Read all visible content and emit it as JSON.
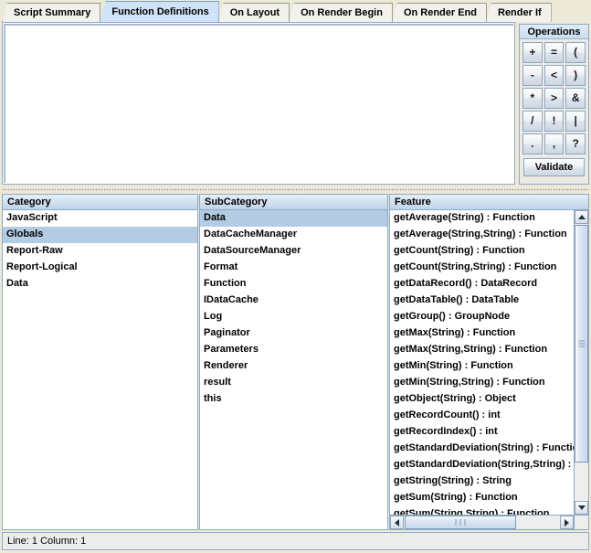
{
  "tabs": [
    {
      "label": "Script Summary",
      "selected": false
    },
    {
      "label": "Function Definitions",
      "selected": true
    },
    {
      "label": "On Layout",
      "selected": false
    },
    {
      "label": "On Render Begin",
      "selected": false
    },
    {
      "label": "On Render End",
      "selected": false
    },
    {
      "label": "Render If",
      "selected": false
    }
  ],
  "editor": {
    "content": "",
    "placeholder": ""
  },
  "operations": {
    "title": "Operations",
    "buttons": [
      "+",
      "=",
      "(",
      "-",
      "<",
      ")",
      "*",
      ">",
      "&",
      "/",
      "!",
      "|",
      ".",
      ",",
      "?"
    ],
    "validate_label": "Validate"
  },
  "category": {
    "header": "Category",
    "items": [
      {
        "label": "JavaScript",
        "selected": false
      },
      {
        "label": "Globals",
        "selected": true
      },
      {
        "label": "Report-Raw",
        "selected": false
      },
      {
        "label": "Report-Logical",
        "selected": false
      },
      {
        "label": "Data",
        "selected": false
      }
    ]
  },
  "subcategory": {
    "header": "SubCategory",
    "items": [
      {
        "label": "Data",
        "selected": true
      },
      {
        "label": "DataCacheManager",
        "selected": false
      },
      {
        "label": "DataSourceManager",
        "selected": false
      },
      {
        "label": "Format",
        "selected": false
      },
      {
        "label": "Function",
        "selected": false
      },
      {
        "label": "IDataCache",
        "selected": false
      },
      {
        "label": "Log",
        "selected": false
      },
      {
        "label": "Paginator",
        "selected": false
      },
      {
        "label": "Parameters",
        "selected": false
      },
      {
        "label": "Renderer",
        "selected": false
      },
      {
        "label": "result",
        "selected": false
      },
      {
        "label": "this",
        "selected": false
      }
    ]
  },
  "feature": {
    "header": "Feature",
    "items": [
      {
        "label": "getAverage(String) : Function",
        "selected": false
      },
      {
        "label": "getAverage(String,String) : Function",
        "selected": false
      },
      {
        "label": "getCount(String) : Function",
        "selected": false
      },
      {
        "label": "getCount(String,String) : Function",
        "selected": false
      },
      {
        "label": "getDataRecord() : DataRecord",
        "selected": false
      },
      {
        "label": "getDataTable() : DataTable",
        "selected": false
      },
      {
        "label": "getGroup() : GroupNode",
        "selected": false
      },
      {
        "label": "getMax(String) : Function",
        "selected": false
      },
      {
        "label": "getMax(String,String) : Function",
        "selected": false
      },
      {
        "label": "getMin(String) : Function",
        "selected": false
      },
      {
        "label": "getMin(String,String) : Function",
        "selected": false
      },
      {
        "label": "getObject(String) : Object",
        "selected": false
      },
      {
        "label": "getRecordCount() : int",
        "selected": false
      },
      {
        "label": "getRecordIndex() : int",
        "selected": false
      },
      {
        "label": "getStandardDeviation(String) : Function",
        "selected": false
      },
      {
        "label": "getStandardDeviation(String,String) : Function",
        "selected": false
      },
      {
        "label": "getString(String) : String",
        "selected": false
      },
      {
        "label": "getSum(String) : Function",
        "selected": false
      },
      {
        "label": "getSum(String,String) : Function",
        "selected": false
      }
    ]
  },
  "statusbar": {
    "text": "Line: 1 Column: 1"
  },
  "colors": {
    "window_bg": "#ece9d8",
    "selected_tab_bg": "#cfe2f7",
    "list_selection_bg": "#b3cbe3",
    "border": "#8ea9c6",
    "header_gradient_top": "#e6eff8",
    "header_gradient_bottom": "#bfd3e9"
  }
}
